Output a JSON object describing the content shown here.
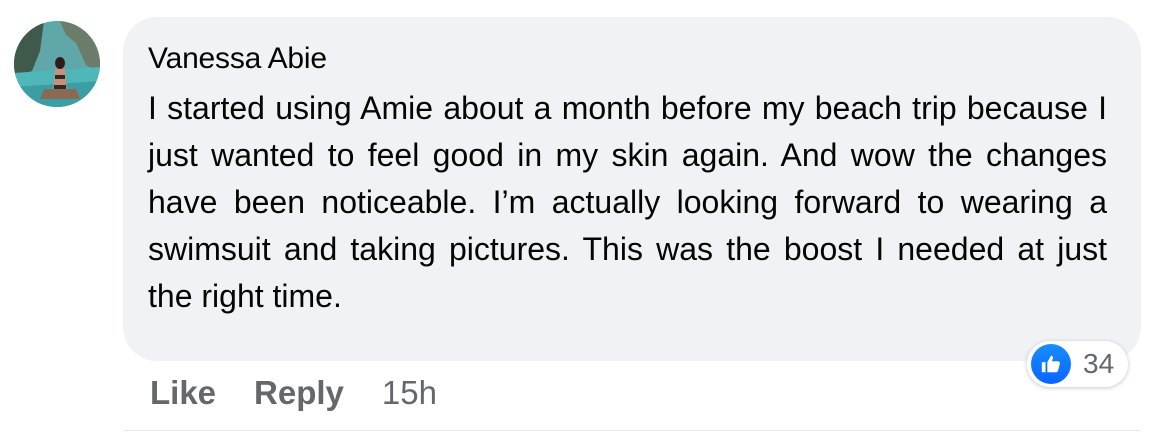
{
  "comment": {
    "author": "Vanessa Abie",
    "text": "I started using Amie about a month before my beach trip because I just wanted to feel good in my skin again. And wow the changes have been noticeable. I’m actually looking forward to wearing a swimsuit and taking pictures. This was the boost I needed at just the right time.",
    "avatar_icon": "avatar-photo"
  },
  "reactions": {
    "icon": "thumbs-up-icon",
    "count": "34",
    "color": "#0866ff"
  },
  "actions": {
    "like_label": "Like",
    "reply_label": "Reply",
    "timestamp": "15h"
  }
}
